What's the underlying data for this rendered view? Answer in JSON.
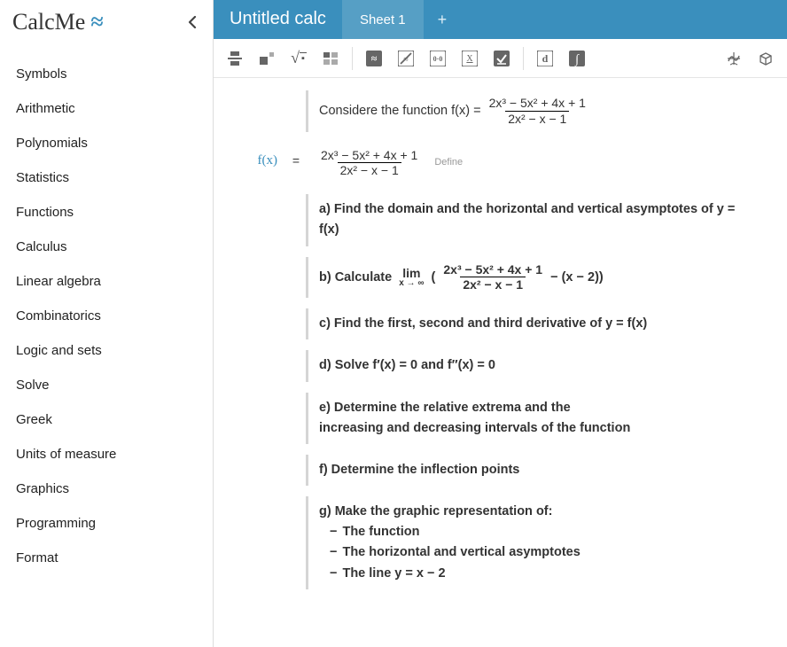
{
  "app": {
    "name": "CalcMe"
  },
  "sidebar": {
    "items": [
      {
        "label": "Symbols"
      },
      {
        "label": "Arithmetic"
      },
      {
        "label": "Polynomials"
      },
      {
        "label": "Statistics"
      },
      {
        "label": "Functions"
      },
      {
        "label": "Calculus"
      },
      {
        "label": "Linear algebra"
      },
      {
        "label": "Combinatorics"
      },
      {
        "label": "Logic and sets"
      },
      {
        "label": "Solve"
      },
      {
        "label": "Greek"
      },
      {
        "label": "Units of measure"
      },
      {
        "label": "Graphics"
      },
      {
        "label": "Programming"
      },
      {
        "label": "Format"
      }
    ]
  },
  "header": {
    "title": "Untitled calc",
    "tab": "Sheet 1",
    "add": "+"
  },
  "toolbar": {
    "frac": "fraction",
    "exp": "exponent",
    "sqrt": "square-root",
    "matrix": "matrix",
    "approx": "approx",
    "nsolve": "not-solve",
    "decimal": "decimal",
    "cross": "evaluate",
    "check": "assign",
    "d": "derivative",
    "int": "integral",
    "plot": "plot-2d",
    "plot3": "plot-3d"
  },
  "doc": {
    "intro_prefix": "Considere the function f(x) = ",
    "func_label": "f(x)",
    "eq": "=",
    "numerator": "2x³ − 5x² + 4x + 1",
    "denominator": "2x² − x − 1",
    "define": "Define",
    "a": "a) Find the domain and the horizontal and vertical asymptotes of y = f(x)",
    "b_prefix": "b) Calculate ",
    "b_lim_top": "lim",
    "b_lim_sub": "x → ∞",
    "b_open": "(",
    "b_minus": " − (x − 2))",
    "c": "c) Find the first, second and third derivative of y = f(x)",
    "d": "d) Solve f′(x) = 0 and f′′(x) = 0",
    "e1": "e) Determine the relative extrema and the",
    "e2": "increasing and decreasing intervals of the function",
    "f": "f) Determine the inflection points",
    "g0": "g) Make the graphic representation of:",
    "g1": "The function",
    "g2": "The horizontal and vertical asymptotes",
    "g3": "The line y = x − 2",
    "dash": "−"
  }
}
